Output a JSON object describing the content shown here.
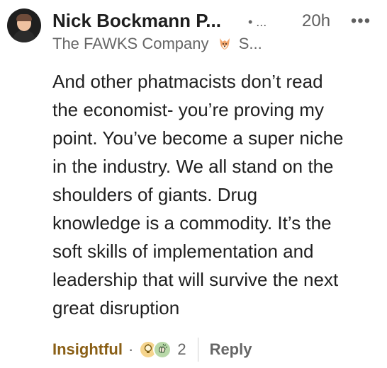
{
  "comment": {
    "author_name": "Nick Bockmann P...",
    "degree": "• ...",
    "timestamp": "20h",
    "more_label": "•••",
    "headline_prefix": "The FAWKS Company",
    "headline_suffix": "S...",
    "text": "And other phatmacists don’t read\nthe economist- you’re proving my\npoint. You’ve become a super niche\nin the industry. We all stand on the\nshoulders of giants. Drug\nknowledge is a commodity. It’s the\nsoft skills of implementation and\nleadership that will survive the next\ngreat disruption"
  },
  "footer": {
    "reaction_label": "Insightful",
    "separator": "·",
    "reaction_count": "2",
    "reply_label": "Reply"
  },
  "icons": {
    "avatar": "profile-photo",
    "fox": "fox-emoji",
    "insightful": "lightbulb-icon",
    "celebrate": "clapping-hands-icon",
    "more": "more-horizontal-icon"
  },
  "colors": {
    "insightful": "#8a5f16",
    "text": "#1f1f1f",
    "muted": "#666666"
  }
}
